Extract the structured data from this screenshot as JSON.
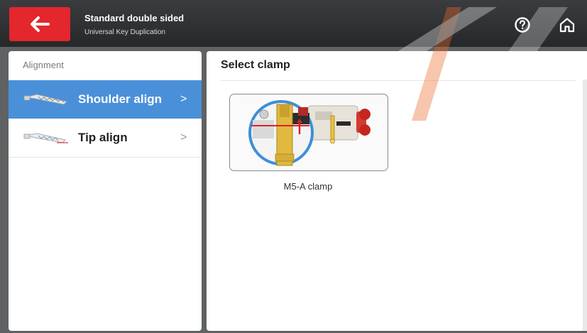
{
  "header": {
    "title": "Standard double sided",
    "subtitle": "Universal Key Duplication",
    "back_icon": "arrow-left-icon",
    "help_icon": "help-circle-icon",
    "home_icon": "home-icon"
  },
  "sidebar": {
    "section_label": "Alignment",
    "items": [
      {
        "label": "Shoulder align",
        "chevron": ">",
        "active": true,
        "icon": "key-shoulder-icon"
      },
      {
        "label": "Tip align",
        "chevron": ">",
        "active": false,
        "icon": "key-tip-icon"
      }
    ]
  },
  "main": {
    "title": "Select clamp",
    "clamps": [
      {
        "label": "M5-A clamp",
        "icon": "clamp-image"
      }
    ]
  },
  "colors": {
    "accent": "#e4262d",
    "active_item": "#4a90d9",
    "header_bg": "#2f3134"
  }
}
